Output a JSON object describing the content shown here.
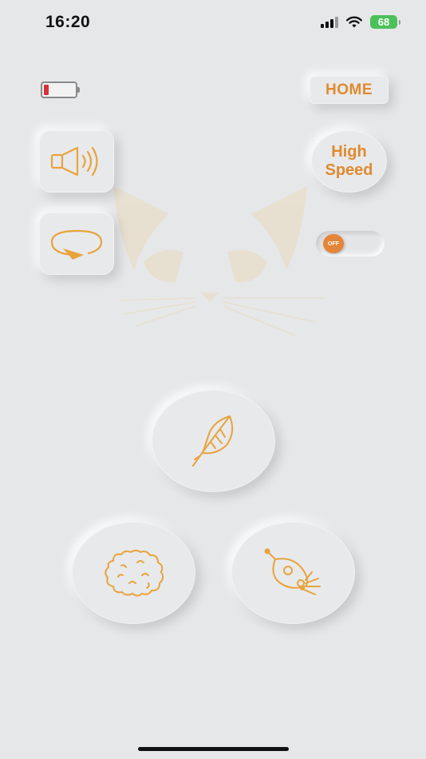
{
  "status_bar": {
    "time": "16:20",
    "battery_percent": "68",
    "battery_color": "#4cc15a",
    "signal_icon": "signal-icon",
    "wifi_icon": "wifi-icon"
  },
  "device": {
    "battery_level_fraction": 0.1,
    "battery_low_color": "#d8313a"
  },
  "controls": {
    "home_label": "HOME",
    "sound_icon": "speaker-icon",
    "rotate_icon": "rotate-icon",
    "speed_label_line1": "High",
    "speed_label_line2": "Speed",
    "toggle_state": "OFF"
  },
  "modes": [
    {
      "name": "feather",
      "icon": "feather-icon"
    },
    {
      "name": "yarn",
      "icon": "yarn-ball-icon"
    },
    {
      "name": "mouse",
      "icon": "mouse-icon"
    }
  ],
  "theme": {
    "accent": "#e08a2e",
    "icon_color": "#e8a33c",
    "background": "#e6e7e9"
  }
}
